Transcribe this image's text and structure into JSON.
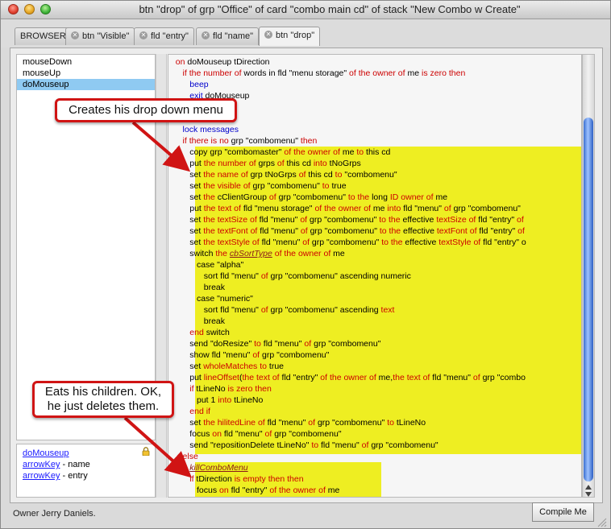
{
  "window": {
    "title": "btn \"drop\" of grp \"Office\" of card \"combo main cd\" of stack \"New Combo w Create\""
  },
  "tabs": [
    {
      "label": "BROWSER",
      "closable": false
    },
    {
      "label": "btn \"Visible\"",
      "closable": true
    },
    {
      "label": "fld \"entry\"",
      "closable": true
    },
    {
      "label": "fld \"name\"",
      "closable": true
    },
    {
      "label": "btn \"drop\"",
      "closable": true,
      "active": true
    }
  ],
  "handlers": [
    {
      "label": "mouseDown",
      "selected": false
    },
    {
      "label": "mouseUp",
      "selected": false
    },
    {
      "label": "doMouseup",
      "selected": true
    }
  ],
  "calls": [
    {
      "handler": "doMouseup",
      "note": ""
    },
    {
      "handler": "arrowKey",
      "note": " - name"
    },
    {
      "handler": "arrowKey",
      "note": " - entry"
    }
  ],
  "code_lines": [
    "on doMouseup tDirection",
    "   if the number of words in fld \"menu storage\" of the owner of me is zero then",
    "      beep",
    "      exit doMouseup",
    "",
    "",
    "   lock messages",
    "   if there is no grp \"combomenu\" then",
    "      copy grp \"combomaster\" of the owner of me to this cd",
    "      put the number of grps of this cd into tNoGrps",
    "      set the name of grp tNoGrps of this cd to \"combomenu\"",
    "      set the visible of grp \"combomenu\" to true",
    "      set the cClientGroup of grp \"combomenu\" to the long ID owner of me",
    "      put the text of fld \"menu storage\" of the owner of me into fld \"menu\" of grp \"combomenu\"",
    "      set the textSize of fld \"menu\" of grp \"combomenu\" to the effective textSize of fld \"entry\" of",
    "      set the textFont of fld \"menu\" of grp \"combomenu\" to the effective textFont of fld \"entry\" of",
    "      set the textStyle of fld \"menu\" of grp \"combomenu\" to the effective textStyle of fld \"entry\" o",
    "      switch the cbSortType of the owner of me",
    "         case \"alpha\"",
    "            sort fld \"menu\" of grp \"combomenu\" ascending numeric",
    "            break",
    "         case \"numeric\"",
    "            sort fld \"menu\" of grp \"combomenu\" ascending text",
    "            break",
    "      end switch",
    "      send \"doResize\" to fld \"menu\" of grp \"combomenu\"",
    "      show fld \"menu\" of grp \"combomenu\"",
    "      set wholeMatches to true",
    "      put lineOffset(the text of fld \"entry\" of the owner of me,the text of fld \"menu\" of grp \"combo",
    "      if tLineNo is zero then",
    "         put 1 into tLineNo",
    "      end if",
    "      set the hilitedLine of fld \"menu\" of grp \"combomenu\" to tLineNo",
    "      focus on fld \"menu\" of grp \"combomenu\"",
    "      send \"repositionDelete tLineNo\" to fld \"menu\" of grp \"combomenu\"",
    "   else",
    "      killComboMenu",
    "      if tDirection is empty then then",
    "         focus on fld \"entry\" of the owner of me"
  ],
  "annotations": {
    "callout1": "Creates his drop down menu",
    "callout2_line1": "Eats his children. OK,",
    "callout2_line2": "he just deletes them."
  },
  "footer": {
    "owner": "Owner Jerry Daniels.",
    "compile_label": "Compile Me"
  },
  "colors": {
    "highlight": "#eeee22",
    "keyword": "#cc0000",
    "command": "#0000cc",
    "selection": "#8fcaf2",
    "callout_border": "#d01414"
  }
}
